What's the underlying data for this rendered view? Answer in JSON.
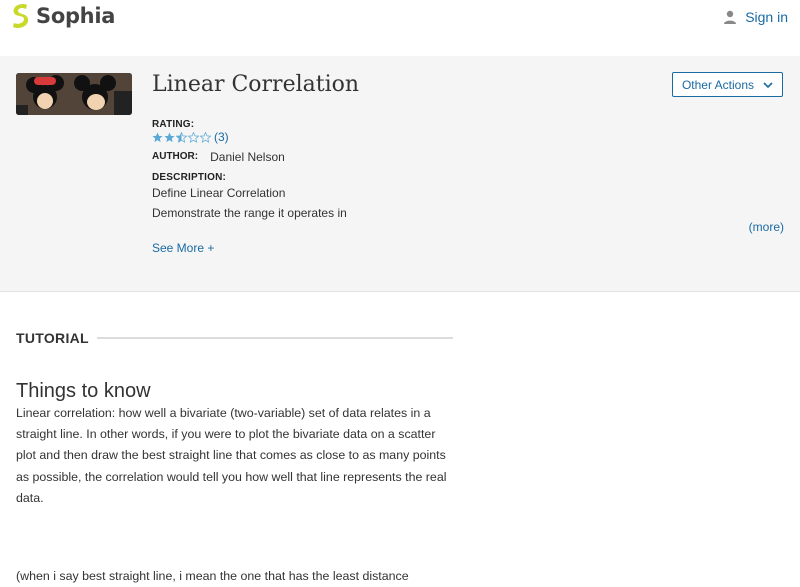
{
  "header": {
    "brand": "Sophia",
    "signin_label": "Sign in"
  },
  "resource": {
    "title": "Linear Correlation",
    "other_actions_label": "Other Actions",
    "rating_label": "RATING:",
    "rating_stars": 2.5,
    "rating_count": "(3)",
    "author_label": "AUTHOR:",
    "author": "Daniel Nelson",
    "description_label": "DESCRIPTION:",
    "description_lines": [
      "Define Linear Correlation",
      "Demonstrate the range it operates in"
    ],
    "more_label": "(more)",
    "see_more_label": "See More +"
  },
  "tutorial": {
    "label": "TUTORIAL",
    "heading": "Things to know",
    "paragraph": "Linear correlation: how well a bivariate (two-variable) set of data relates in a straight line. In other words, if you were to plot the bivariate data on a scatter plot and then draw the best straight line that comes as close to as many points as possible, the correlation would tell you how well that line represents the real data.",
    "paragraph2": "(when i say best straight line, i mean the one that has the least distance"
  },
  "colors": {
    "link": "#1a6aa3",
    "brand_logo": "#c8d92a",
    "star": "#5aa9d6"
  }
}
